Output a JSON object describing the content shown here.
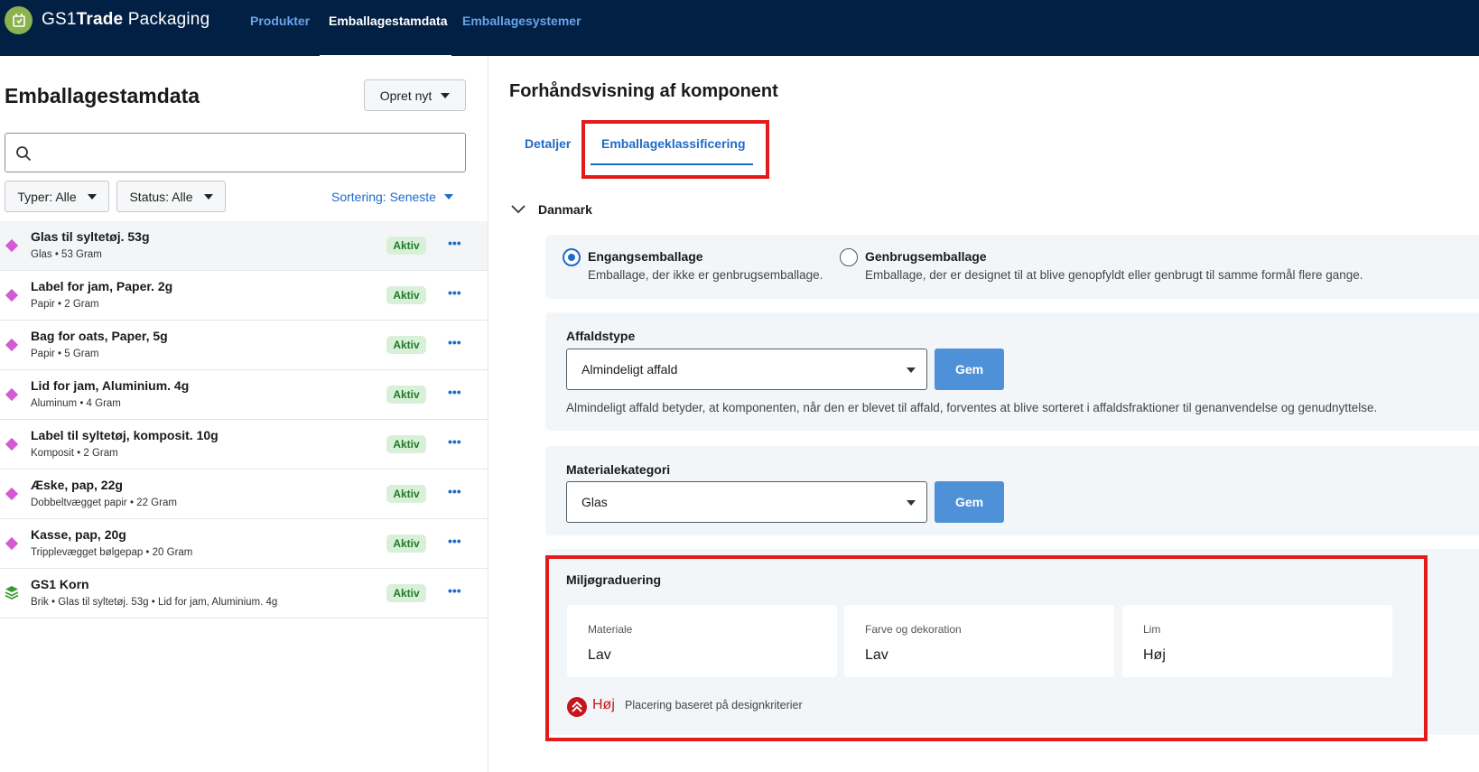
{
  "app": {
    "brand_prefix": "GS1",
    "brand_bold": "Trade",
    "brand_suffix": " Packaging"
  },
  "nav": {
    "items": [
      "Produkter",
      "Emballagestamdata",
      "Emballagesystemer"
    ],
    "active": "Emballagestamdata"
  },
  "left": {
    "title": "Emballagestamdata",
    "create_button": "Opret nyt",
    "search_placeholder": "",
    "filter_types": "Typer: Alle",
    "filter_status": "Status: Alle",
    "sort": "Sortering: Seneste",
    "items": [
      {
        "name": "Glas til syltetøj. 53g",
        "sub": "Glas • 53 Gram",
        "status": "Aktiv",
        "icon": "diamond-icon",
        "selected": true
      },
      {
        "name": "Label for jam, Paper. 2g",
        "sub": "Papir • 2 Gram",
        "status": "Aktiv",
        "icon": "diamond-icon"
      },
      {
        "name": "Bag for oats, Paper, 5g",
        "sub": "Papir • 5 Gram",
        "status": "Aktiv",
        "icon": "diamond-icon"
      },
      {
        "name": "Lid for jam, Aluminium. 4g",
        "sub": "Aluminum • 4 Gram",
        "status": "Aktiv",
        "icon": "diamond-icon"
      },
      {
        "name": "Label til syltetøj, komposit. 10g",
        "sub": "Komposit • 2 Gram",
        "status": "Aktiv",
        "icon": "diamond-icon"
      },
      {
        "name": "Æske, pap, 22g",
        "sub": "Dobbeltvægget papir • 22 Gram",
        "status": "Aktiv",
        "icon": "diamond-icon"
      },
      {
        "name": "Kasse, pap, 20g",
        "sub": "Tripplevægget bølgepap • 20 Gram",
        "status": "Aktiv",
        "icon": "diamond-icon"
      },
      {
        "name": "GS1 Korn",
        "sub": "Brik • Glas til syltetøj. 53g • Lid for jam, Aluminium. 4g",
        "status": "Aktiv",
        "icon": "layers-icon"
      }
    ]
  },
  "right": {
    "title": "Forhåndsvisning af komponent",
    "tabs": [
      "Detaljer",
      "Emballageklassificering"
    ],
    "active_tab": "Emballageklassificering",
    "section": "Danmark",
    "radio": [
      {
        "title": "Engangsemballage",
        "desc": "Emballage, der ikke er genbrugsemballage.",
        "checked": true
      },
      {
        "title": "Genbrugsemballage",
        "desc": "Emballage, der er designet til at blive genopfyldt eller genbrugt til samme formål flere gange.",
        "checked": false
      }
    ],
    "waste": {
      "label": "Affaldstype",
      "value": "Almindeligt affald",
      "button": "Gem",
      "help": "Almindeligt affald betyder, at komponenten, når den er blevet til affald, forventes at blive sorteret i affaldsfraktioner til genanvendelse og genudnyttelse."
    },
    "material": {
      "label": "Materialekategori",
      "value": "Glas",
      "button": "Gem"
    },
    "grading": {
      "label": "Miljøgraduering",
      "cards": [
        {
          "label": "Materiale",
          "value": "Lav"
        },
        {
          "label": "Farve og dekoration",
          "value": "Lav"
        },
        {
          "label": "Lim",
          "value": "Høj"
        }
      ],
      "result": "Høj",
      "result_desc": "Placering baseret på designkriterier"
    }
  },
  "colors": {
    "nav_bg": "#022043",
    "accent": "#1f6bc9",
    "highlight": "#e21b1b",
    "active_badge_bg": "#d9f0d8",
    "active_badge_text": "#1e7a29",
    "high_grade": "#c4161c"
  }
}
